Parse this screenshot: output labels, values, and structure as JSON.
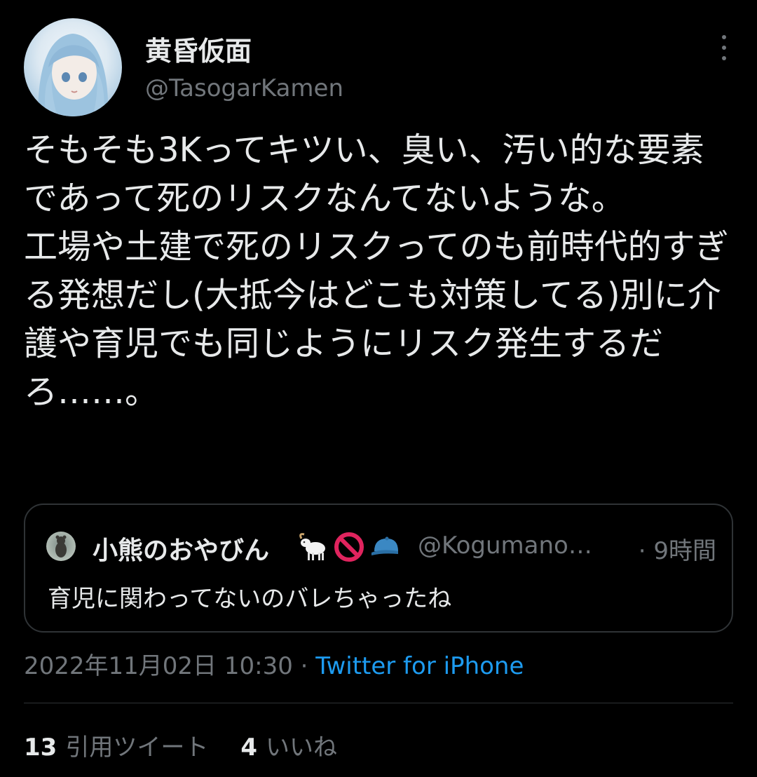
{
  "author": {
    "display_name": "黄昏仮面",
    "handle": "@TasogarKamen"
  },
  "tweet": {
    "text": "そもそも3Kってキツい、臭い、汚い的な要素であって死のリスクなんてないような。\n工場や土建で死のリスクってのも前時代的すぎる発想だし(大抵今はどこも対策してる)別に介護や育児でも同じようにリスク発生するだろ……。"
  },
  "quoted_tweet": {
    "display_name": "小熊のおやびん",
    "emojis": [
      "goat-emoji",
      "no-entry-emoji",
      "cap-emoji"
    ],
    "handle": "@Kogumano…",
    "time": "· 9時間",
    "text": "育児に関わってないのバレちゃったね"
  },
  "meta": {
    "timestamp": "2022年11月02日 10:30",
    "separator": "·",
    "source": "Twitter for iPhone"
  },
  "stats": {
    "quote_count": "13",
    "quote_label": "引用ツイート",
    "like_count": "4",
    "like_label": "いいね"
  },
  "colors": {
    "background": "#000000",
    "text": "#e7e9ea",
    "secondary": "#71767b",
    "link": "#1d9bf0",
    "border": "#2f3336"
  }
}
